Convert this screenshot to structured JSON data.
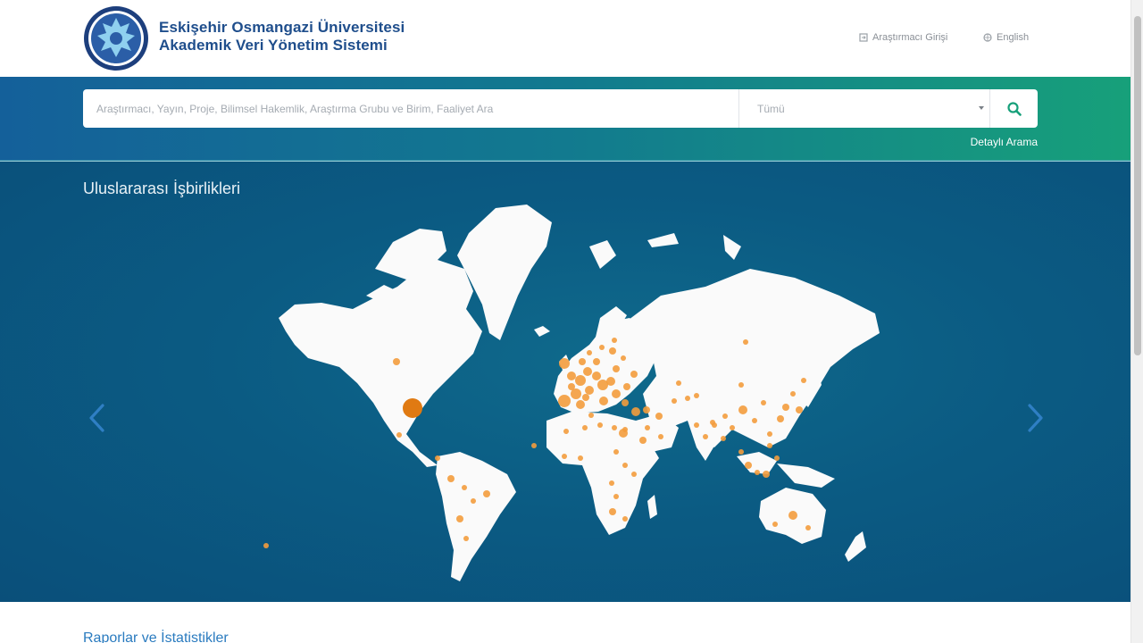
{
  "header": {
    "title_line1": "Eskişehir Osmangazi Üniversitesi",
    "title_line2": "Akademik Veri Yönetim Sistemi",
    "links": [
      {
        "label": "Araştırmacı Girişi",
        "icon": "login-icon"
      },
      {
        "label": "English",
        "icon": "globe-icon"
      }
    ]
  },
  "search": {
    "placeholder": "Araştırmacı, Yayın, Proje, Bilimsel Hakemlik, Araştırma Grubu ve Birim, Faaliyet Ara",
    "type_label": "Tümü",
    "button_icon": "search-icon",
    "advanced_label": "Detaylı Arama"
  },
  "map": {
    "title": "Uluslararası İşbirlikleri",
    "prev_icon": "chevron-left-icon",
    "next_icon": "chevron-right-icon",
    "land_color": "#fafafa",
    "marker_color": "#f39c3d",
    "marker_dark_color": "#e07a12"
  },
  "footer": {
    "reports_title": "Raporlar ve İstatistikler"
  }
}
